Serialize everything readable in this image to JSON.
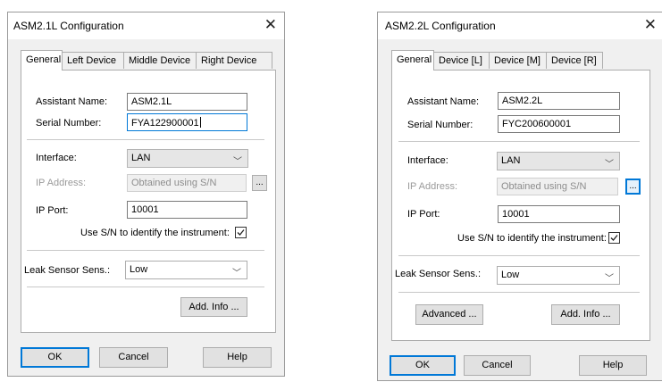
{
  "dialog1": {
    "title": "ASM2.1L Configuration",
    "tabs": [
      "General",
      "Left Device",
      "Middle Device",
      "Right Device"
    ],
    "assistant_name_label": "Assistant Name:",
    "assistant_name_value": "ASM2.1L",
    "serial_number_label": "Serial Number:",
    "serial_number_value": "FYA122900001",
    "interface_label": "Interface:",
    "interface_value": "LAN",
    "ip_address_label": "IP Address:",
    "ip_address_value": "Obtained using S/N",
    "browse_label": "...",
    "ip_port_label": "IP Port:",
    "ip_port_value": "10001",
    "use_sn_label": "Use S/N to identify the instrument:",
    "use_sn_checked": true,
    "leak_sensor_label": "Leak Sensor Sens.:",
    "leak_sensor_value": "Low",
    "add_info_label": "Add. Info ...",
    "ok_label": "OK",
    "cancel_label": "Cancel",
    "help_label": "Help"
  },
  "dialog2": {
    "title": "ASM2.2L Configuration",
    "tabs": [
      "General",
      "Device [L]",
      "Device [M]",
      "Device [R]"
    ],
    "assistant_name_label": "Assistant Name:",
    "assistant_name_value": "ASM2.2L",
    "serial_number_label": "Serial Number:",
    "serial_number_value": "FYC200600001",
    "interface_label": "Interface:",
    "interface_value": "LAN",
    "ip_address_label": "IP Address:",
    "ip_address_value": "Obtained using S/N",
    "browse_label": "...",
    "ip_port_label": "IP Port:",
    "ip_port_value": "10001",
    "use_sn_label": "Use S/N to identify the instrument:",
    "use_sn_checked": true,
    "leak_sensor_label": "Leak Sensor Sens.:",
    "leak_sensor_value": "Low",
    "advanced_label": "Advanced ...",
    "add_info_label": "Add. Info ...",
    "ok_label": "OK",
    "cancel_label": "Cancel",
    "help_label": "Help"
  },
  "icons": {
    "close": "close-icon",
    "chevron": "chevron-down-icon",
    "check": "checkmark-icon"
  },
  "colors": {
    "focus_accent": "#0078d7",
    "dialog_bg": "#f0f0f0",
    "panel_bg": "#ffffff"
  }
}
